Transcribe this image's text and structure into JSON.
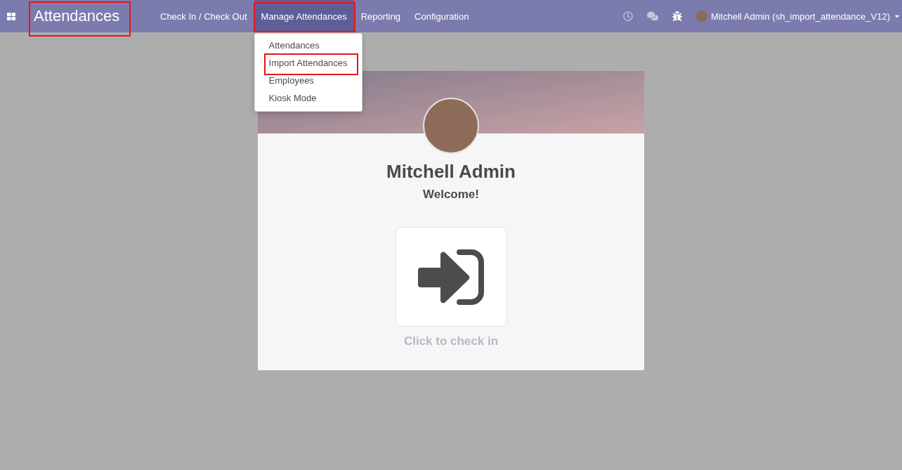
{
  "navbar": {
    "app_title": {
      "text": "Attendances",
      "highlighted": true
    },
    "menu": [
      {
        "label": "Check In / Check Out",
        "selected": false,
        "highlighted": false
      },
      {
        "label": "Manage Attendances",
        "selected": true,
        "highlighted": true,
        "submenu": [
          {
            "label": "Attendances",
            "highlighted": false
          },
          {
            "label": "Import Attendances",
            "highlighted": true
          },
          {
            "label": "Employees",
            "highlighted": false
          },
          {
            "label": "Kiosk Mode",
            "highlighted": false
          }
        ]
      },
      {
        "label": "Reporting",
        "selected": false,
        "highlighted": false
      },
      {
        "label": "Configuration",
        "selected": false,
        "highlighted": false
      }
    ],
    "user": {
      "name": "Mitchell Admin (sh_import_attendance_V12)"
    }
  },
  "kiosk": {
    "employee_name": "Mitchell Admin",
    "greeting": "Welcome!",
    "action_label": "Click to check in"
  }
}
